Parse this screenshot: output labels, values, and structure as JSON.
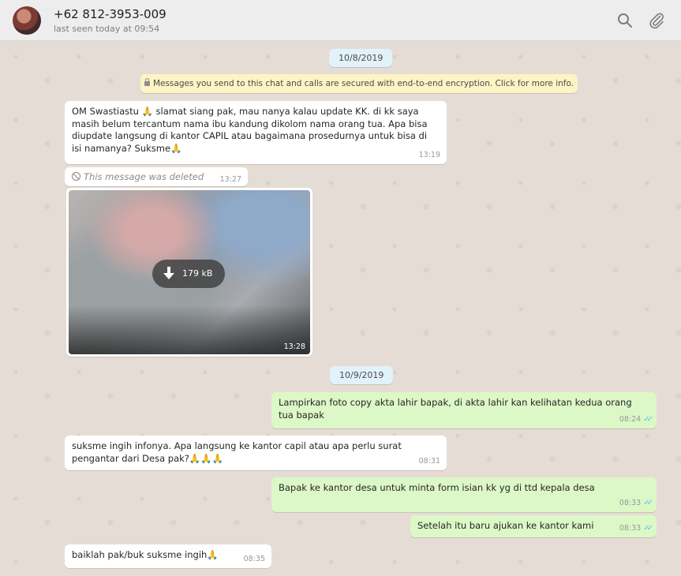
{
  "header": {
    "contact_name": "+62 812-3953-009",
    "last_seen": "last seen today at 09:54",
    "icons": [
      "search-icon",
      "paperclip-icon"
    ]
  },
  "chat": {
    "date_1": "10/8/2019",
    "encryption_notice": "Messages you send to this chat and calls are secured with end-to-end encryption. Click for more info.",
    "msg1": {
      "text": "OM Swastiastu 🙏 slamat siang pak, mau nanya kalau update KK. di kk saya masih belum tercantum nama ibu kandung dikolom nama orang tua. Apa bisa diupdate  langsung di kantor CAPIL atau bagaimana prosedurnya untuk bisa di isi namanya? Suksme🙏",
      "time": "13:19"
    },
    "deleted": {
      "text": "This message was deleted",
      "time": "13:27"
    },
    "image": {
      "size": "179 kB",
      "time": "13:28"
    },
    "date_2": "10/9/2019",
    "msg2": {
      "text": "Lampirkan foto copy akta lahir bapak, di akta lahir kan kelihatan kedua orang tua bapak",
      "time": "08:24"
    },
    "msg3": {
      "text": "suksme ingih infonya. Apa langsung ke kantor capil  atau apa perlu surat pengantar dari Desa pak?🙏🙏🙏",
      "time": "08:31"
    },
    "msg4": {
      "text": "Bapak ke kantor desa untuk minta form isian kk yg di ttd kepala desa",
      "time": "08:33"
    },
    "msg5": {
      "text": "Setelah itu baru ajukan ke kantor kami",
      "time": "08:33"
    },
    "msg6": {
      "text": "baiklah pak/buk suksme ingih🙏",
      "time": "08:35"
    }
  },
  "colors": {
    "incoming": "#ffffff",
    "outgoing": "#dcf8c6",
    "background": "#e5ddd5",
    "read_ticks": "#4fc3f7"
  }
}
